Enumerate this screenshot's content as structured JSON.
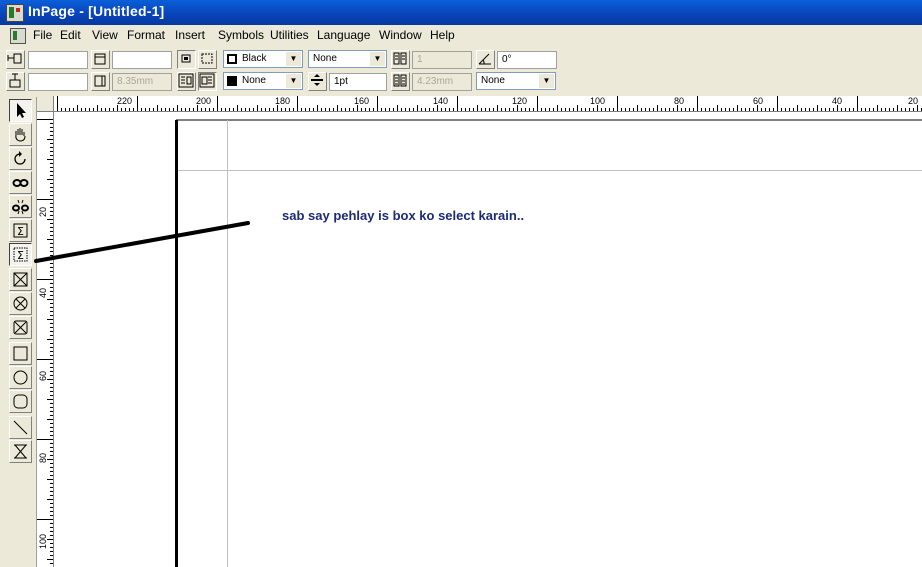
{
  "window": {
    "title": "InPage - [Untitled-1]"
  },
  "menubar": {
    "items": [
      {
        "label": "File",
        "key": "file"
      },
      {
        "label": "Edit",
        "key": "edit"
      },
      {
        "label": "View",
        "key": "view"
      },
      {
        "label": "Format",
        "key": "format"
      },
      {
        "label": "Insert",
        "key": "insert"
      },
      {
        "label": "Symbols",
        "key": "symbols"
      },
      {
        "label": "Utilities",
        "key": "utilities"
      },
      {
        "label": "Language",
        "key": "language"
      },
      {
        "label": "Window",
        "key": "window"
      },
      {
        "label": "Help",
        "key": "help"
      }
    ]
  },
  "toolbar": {
    "row1": {
      "x_field": "",
      "width_field": "",
      "line_color": "Black",
      "fill_none": "None",
      "columns_field": "1",
      "angle_field": "0°"
    },
    "row2": {
      "y_field": "",
      "height_field": "8.35mm",
      "fill_color": "None",
      "line_weight": "1pt",
      "gutter_field": "4.23mm",
      "shade_none": "None"
    },
    "colors": {
      "black": "#000000",
      "accent": "#0842b8"
    }
  },
  "tools": [
    {
      "name": "pointer-tool-icon"
    },
    {
      "name": "hand-tool-icon"
    },
    {
      "name": "rotate-tool-icon"
    },
    {
      "name": "link-tool-icon"
    },
    {
      "name": "unlink-tool-icon"
    },
    {
      "name": "text-tool-icon"
    },
    {
      "name": "text-box-tool-icon"
    },
    {
      "name": "rect-picture-box-tool-icon"
    },
    {
      "name": "oval-picture-box-tool-icon"
    },
    {
      "name": "rounded-picture-box-tool-icon"
    },
    {
      "name": "rectangle-tool-icon"
    },
    {
      "name": "oval-tool-icon"
    },
    {
      "name": "rounded-rectangle-tool-icon"
    },
    {
      "name": "line-tool-icon"
    },
    {
      "name": "hourglass-tool-icon"
    }
  ],
  "ruler": {
    "horizontal": [
      "220",
      "200",
      "180",
      "160",
      "140",
      "120",
      "100",
      "80",
      "60",
      "40",
      "20"
    ],
    "vertical": [
      "20",
      "40",
      "60",
      "80",
      "100"
    ]
  },
  "canvas": {
    "annotation": "sab say pehlay is box ko select karain.."
  }
}
